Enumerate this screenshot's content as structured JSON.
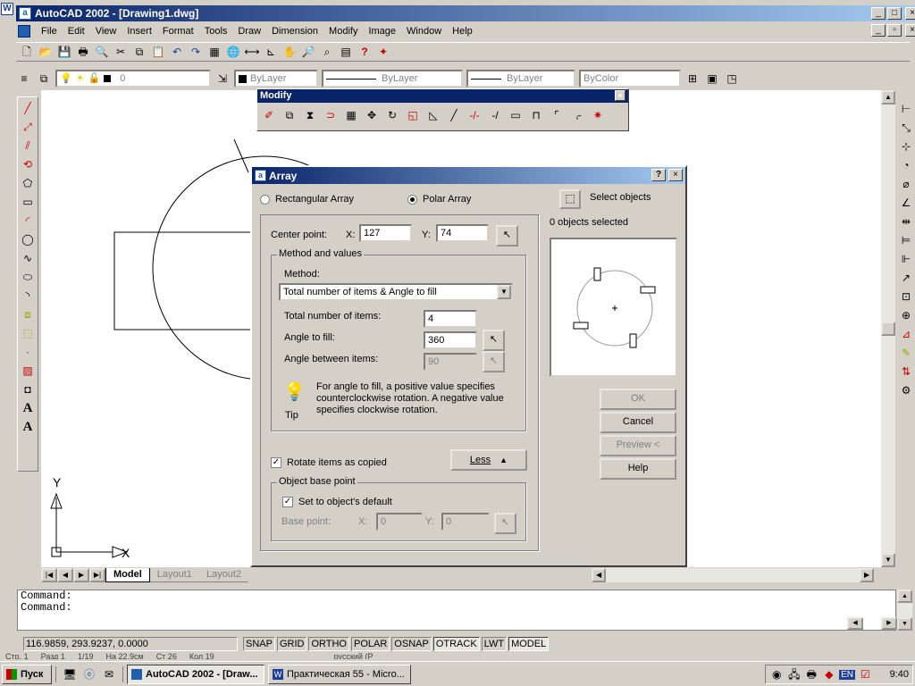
{
  "app": {
    "title": "AutoCAD 2002 - [Drawing1.dwg]",
    "sysicon_letter": "W"
  },
  "menu": [
    "File",
    "Edit",
    "View",
    "Insert",
    "Format",
    "Tools",
    "Draw",
    "Dimension",
    "Modify",
    "Image",
    "Window",
    "Help"
  ],
  "props": {
    "layer": "0",
    "color": "ByLayer",
    "linetype": "ByLayer",
    "lineweight": "ByLayer",
    "plotstyle": "ByColor"
  },
  "modify_toolbar": {
    "title": "Modify"
  },
  "dialog": {
    "title": "Array",
    "rect_label": "Rectangular Array",
    "polar_label": "Polar Array",
    "polar_selected": true,
    "select_objects": "Select objects",
    "selected_count": "0 objects selected",
    "center": {
      "label": "Center point:",
      "x_label": "X:",
      "x": "127",
      "y_label": "Y:",
      "y": "74"
    },
    "method_group": "Method and values",
    "method_label": "Method:",
    "method_value": "Total number of items & Angle to fill",
    "total_label": "Total number of items:",
    "total": "4",
    "angle_label": "Angle to fill:",
    "angle": "360",
    "between_label": "Angle between items:",
    "between": "90",
    "tip": "For angle to fill, a positive value specifies counterclockwise rotation.  A negative value specifies clockwise rotation.",
    "tip_label": "Tip",
    "rotate_label": "Rotate items as copied",
    "rotate_checked": true,
    "less": "Less",
    "base_group": "Object base point",
    "default_label": "Set to object's default",
    "default_checked": true,
    "base_label": "Base point:",
    "bx_label": "X:",
    "bx": "0",
    "by_label": "Y:",
    "by": "0",
    "ok": "OK",
    "cancel": "Cancel",
    "preview": "Preview <",
    "help": "Help"
  },
  "tabs": [
    "Model",
    "Layout1",
    "Layout2"
  ],
  "ucs": {
    "x": "X",
    "y": "Y"
  },
  "command": {
    "line1": "Command:",
    "line2": "Command:"
  },
  "status": {
    "coords": "116.9859, 293.9237, 0.0000",
    "toggles": [
      "SNAP",
      "GRID",
      "ORTHO",
      "POLAR",
      "OSNAP",
      "OTRACK",
      "LWT",
      "MODEL"
    ]
  },
  "taskbar": {
    "start": "Пуск",
    "tasks": [
      "AutoCAD 2002 - [Draw...",
      "Практическая 55 - Micro..."
    ],
    "lang": "EN",
    "clock": "9:40"
  },
  "behind_word": {
    "page": "Стр. 1",
    "section": "Разд 1",
    "pages": "1/19",
    "pos": "На 22,9см",
    "line": "Ст 26",
    "col": "Кол 19",
    "lang": "русский (Р"
  },
  "colors": {
    "title_active": "#0a246a",
    "title_grad": "#a6caf0",
    "desktop": "#d4d0c8"
  }
}
